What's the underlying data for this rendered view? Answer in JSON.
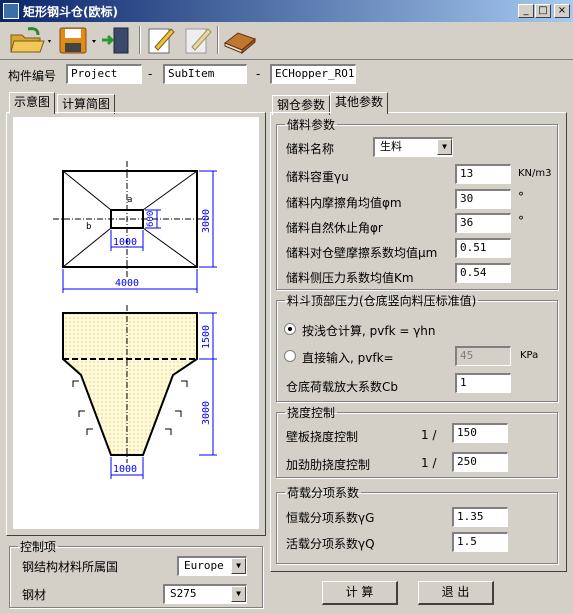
{
  "window": {
    "title": "矩形钢斗仓(欧标)"
  },
  "titlebar_buttons": [
    "_",
    "□",
    "×"
  ],
  "toolbar": {
    "items": [
      "open-folder-icon",
      "save-icon",
      "exit-icon",
      "edit-icon",
      "edit-disabled-icon",
      "book-icon"
    ]
  },
  "component": {
    "label": "构件编号",
    "project": "Project",
    "dash1": "-",
    "subitem": "SubItem",
    "dash2": "-",
    "code": "ECHopper_RO1"
  },
  "left_tabs": [
    "示意图",
    "计算简图"
  ],
  "right_tabs": [
    "钢仓参数",
    "其他参数"
  ],
  "diagram": {
    "plan_a": "a",
    "plan_b": "b",
    "plan_opening_w": "1000",
    "plan_opening_h": "600",
    "plan_height": "3000",
    "plan_width": "4000",
    "elev_top_h": "1500",
    "elev_bottom_h": "3000",
    "elev_opening_w": "1000"
  },
  "storage": {
    "legend": "储料参数",
    "name_label": "储料名称",
    "name_value": "生料",
    "density_label": "储料容重γu",
    "density_value": "13",
    "density_unit": "KN/m3",
    "friction_label": "储料内摩擦角均值φm",
    "friction_value": "30",
    "friction_unit": "°",
    "repose_label": "储料自然休止角φr",
    "repose_value": "36",
    "repose_unit": "°",
    "wall_friction_label": "储料对仓壁摩擦系数均值μm",
    "wall_friction_value": "0.51",
    "lateral_label": "储料侧压力系数均值Km",
    "lateral_value": "0.54"
  },
  "top_pressure": {
    "legend": "料斗顶部压力(仓底竖向料压标准值)",
    "opt1_label": "按浅仓计算, pvfk = γhn",
    "opt2_label": "直接输入, pvfk=",
    "opt2_value": "45",
    "opt2_unit": "KPa",
    "amplify_label": "仓底荷载放大系数Cb",
    "amplify_value": "1"
  },
  "deflection": {
    "legend": "挠度控制",
    "wall_label": "壁板挠度控制",
    "wall_ratio": "1 /",
    "wall_value": "150",
    "stiffener_label": "加劲肋挠度控制",
    "stiffener_ratio": "1 /",
    "stiffener_value": "250"
  },
  "load_factors": {
    "legend": "荷载分项系数",
    "dead_label": "恒载分项系数γG",
    "dead_value": "1.35",
    "live_label": "活载分项系数γQ",
    "live_value": "1.5"
  },
  "control": {
    "legend": "控制项",
    "code_label": "钢结构材料所属国",
    "code_value": "Europe",
    "steel_label": "钢材",
    "steel_value": "S275"
  },
  "buttons": {
    "calc": "计 算",
    "exit": "退 出"
  }
}
